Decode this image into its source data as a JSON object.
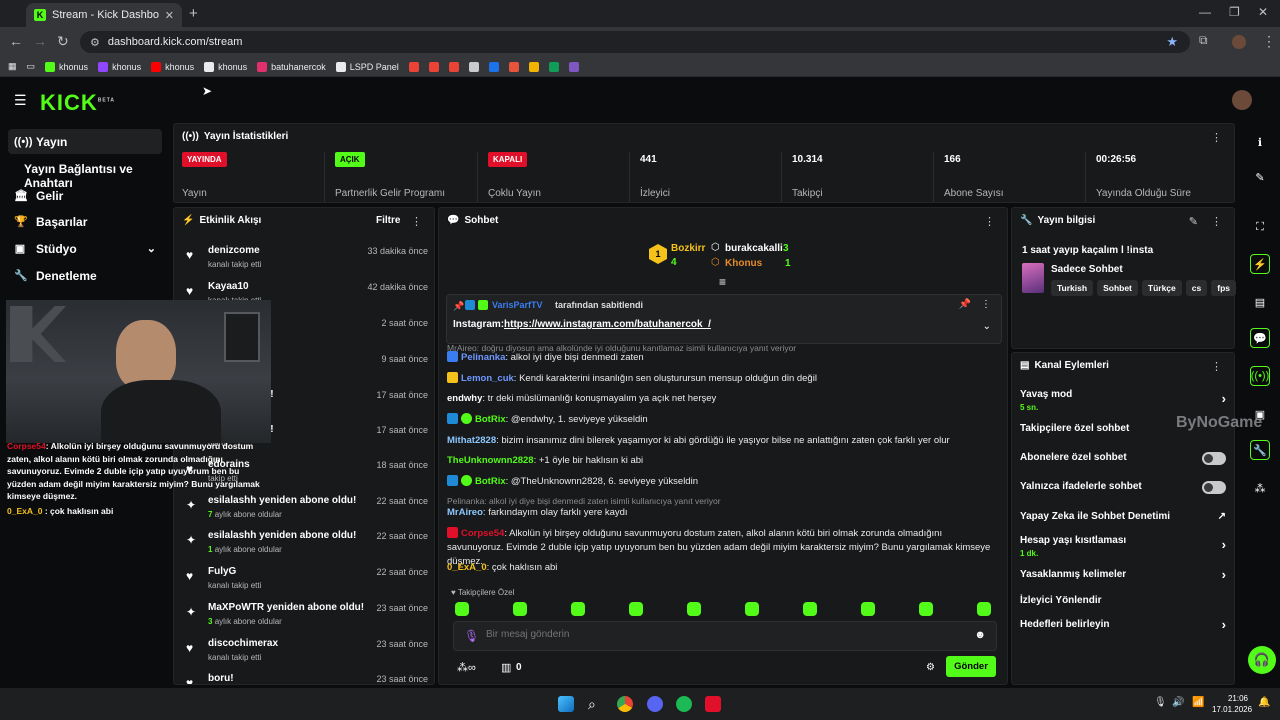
{
  "browser": {
    "tab_title": "Stream - Kick Dashboard",
    "url": "dashboard.kick.com/stream",
    "bookmarks": [
      {
        "label": "khonus",
        "color": "#53fc18"
      },
      {
        "label": "khonus",
        "color": "#9146ff"
      },
      {
        "label": "khonus",
        "color": "#ff0000"
      },
      {
        "label": "khonus",
        "color": "#e8eaed"
      },
      {
        "label": "batuhanercok",
        "color": "#e1306c"
      },
      {
        "label": "LSPD Panel",
        "color": "#e8eaed"
      }
    ]
  },
  "header": {
    "logo": "KICK",
    "logo_beta": "BETA"
  },
  "sidebar": {
    "items": [
      {
        "label": "Yayın",
        "icon": "broadcast-icon"
      },
      {
        "label": "Yayın Bağlantısı ve Anahtarı",
        "icon": ""
      },
      {
        "label": "Gelir",
        "icon": "bank-icon"
      },
      {
        "label": "Başarılar",
        "icon": "trophy-icon"
      },
      {
        "label": "Stüdyo",
        "icon": "studio-icon"
      },
      {
        "label": "Denetleme",
        "icon": "wrench-icon"
      }
    ]
  },
  "stats": {
    "title": "Yayın İstatistikleri",
    "items": [
      {
        "badge": "YAYINDA",
        "badge_color": "#e0102a",
        "label": "Yayın"
      },
      {
        "badge": "AÇIK",
        "badge_color": "#53fc18",
        "label": "Partnerlik Gelir Programı"
      },
      {
        "badge": "KAPALI",
        "badge_color": "#e0102a",
        "label": "Çoklu Yayın"
      },
      {
        "value": "441",
        "label": "İzleyici"
      },
      {
        "value": "10.314",
        "label": "Takipçi"
      },
      {
        "value": "166",
        "label": "Abone Sayısı"
      },
      {
        "value": "00:26:56",
        "label": "Yayında Olduğu Süre"
      }
    ]
  },
  "activity": {
    "title": "Etkinlik Akışı",
    "filter_label": "Filtre",
    "events": [
      {
        "name": "denizcome",
        "sub": "kanalı takip etti",
        "time": "33 dakika önce",
        "icon": "heart-icon"
      },
      {
        "name": "Kayaa10",
        "sub": "kanalı takip etti",
        "time": "42 dakika önce",
        "icon": "heart-icon"
      },
      {
        "name": "m",
        "sub": "",
        "time": "2 saat önce",
        "icon": "heart-icon"
      },
      {
        "name": "",
        "sub": "",
        "time": "9 saat önce",
        "icon": "heart-icon"
      },
      {
        "name": "n abone oldu!",
        "sub": "ulardı",
        "time": "17 saat önce",
        "icon": "star-icon"
      },
      {
        "name": "n abone oldu!",
        "sub": "ulardı",
        "time": "17 saat önce",
        "icon": "star-icon"
      },
      {
        "name": "edorains",
        "sub": "takip etti",
        "time": "18 saat önce",
        "icon": "heart-icon"
      },
      {
        "name": "esilalashh yeniden abone oldu!",
        "sub_count": "7",
        "sub": "aylık abone oldular",
        "time": "22 saat önce",
        "icon": "star-icon"
      },
      {
        "name": "esilalashh yeniden abone oldu!",
        "sub_count": "1",
        "sub": "aylık abone oldular",
        "time": "22 saat önce",
        "icon": "star-icon"
      },
      {
        "name": "FulyG",
        "sub": "kanalı takip etti",
        "time": "22 saat önce",
        "icon": "heart-icon"
      },
      {
        "name": "MaXPoWTR yeniden abone oldu!",
        "sub_count": "3",
        "sub": "aylık abone oldular",
        "time": "23 saat önce",
        "icon": "star-icon"
      },
      {
        "name": "discochimerax",
        "sub": "kanalı takip etti",
        "time": "23 saat önce",
        "icon": "heart-icon"
      },
      {
        "name": "boru!",
        "sub": "",
        "time": "23 saat önce",
        "icon": "heart-icon"
      }
    ]
  },
  "chat": {
    "title": "Sohbet",
    "leaders": [
      {
        "name": "Bozkirr",
        "count": "4"
      },
      {
        "name": "burakcakalli",
        "count": "3"
      },
      {
        "name": "Khonus",
        "count": "1"
      }
    ],
    "pinned_by": "VarisParfTV",
    "pinned_by_suffix": "tarafından sabitlendi",
    "pinned_prefix": "Instagram:",
    "pinned_link": "https://www.instagram.com/batuhanercok_/",
    "reply_preview_top": "MrAireo: doğru diyosun ama alkolünde iyi olduğunu kanıtlamaz isimli kullanıcıya yanıt veriyor",
    "messages": [
      {
        "user": "Pelinanka",
        "color": "#6f98ff",
        "text": "alkol iyi diye bişi denmedi zaten"
      },
      {
        "user": "Lemon_cuk",
        "color": "#6f98ff",
        "text": "Kendi karakterini insanlığın sen oluşturursun mensup olduğun din değil"
      },
      {
        "user": "endwhy",
        "color": "#ffffff",
        "text": "tr deki müslümanlığı konuşmayalım ya açık net herşey"
      },
      {
        "user": "BotRix",
        "color": "#53fc18",
        "text": "@endwhy, 1. seviyeye yükseldin"
      },
      {
        "user": "Mithat2828",
        "color": "#8dc8ff",
        "text": "bizim insanımız dini bilerek yaşamıyor ki abi gördüğü ile yaşıyor bilse ne anlattığını zaten çok farklı yer olur"
      },
      {
        "user": "TheUnknownn2828",
        "color": "#53fc18",
        "text": "+1 öyle bir haklısın ki abi"
      },
      {
        "user": "BotRix",
        "color": "#53fc18",
        "text": "@TheUnknownn2828, 6. seviyeye yükseldin"
      },
      {
        "user": "MrAireo",
        "color": "#8dc8ff",
        "text": "farkındayım olay farklı yere kaydı"
      },
      {
        "user": "Corpse54",
        "color": "#e0102a",
        "text": "Alkolün iyi birşey olduğunu savunmuyoru dostum zaten, alkol alanın kötü biri olmak zorunda olmadığını savunuyoruz. Evimde 2 duble içip yatıp uyuyorum ben bu yüzden adam değil miyim karaktersiz miyim? Bunu yargılamak kimseye düşmez."
      },
      {
        "user": "0_ExA_0",
        "color": "#f5c21b",
        "text": "çok haklısın abi"
      }
    ],
    "reply_preview_mid": "Pelinanka: alkol iyi diye bişi denmedi zaten isimli kullanıcıya yanıt veriyor",
    "followers_only_label": "Takipçilere Özel",
    "input_placeholder": "Bir mesaj gönderin",
    "kicks_count": "0",
    "send_label": "Gönder"
  },
  "stream_info": {
    "title": "Yayın bilgisi",
    "stream_title": "1 saat yayıp kaçalım l !insta",
    "category": "Sadece Sohbet",
    "tags": [
      "Turkish",
      "Sohbet",
      "Türkçe",
      "cs",
      "fps"
    ]
  },
  "channel_actions": {
    "title": "Kanal Eylemleri",
    "items": [
      {
        "label": "Yavaş mod",
        "sub": "5 sn.",
        "control": "chevron"
      },
      {
        "label": "Takipçilere özel sohbet",
        "sub": "",
        "control": "none"
      },
      {
        "label": "Abonelere özel sohbet",
        "sub": "",
        "control": "toggle"
      },
      {
        "label": "Yalnızca ifadelerle sohbet",
        "sub": "",
        "control": "toggle"
      },
      {
        "label": "Yapay Zeka ile Sohbet Denetimi",
        "sub": "",
        "control": "external"
      },
      {
        "label": "Hesap yaşı kısıtlaması",
        "sub": "1 dk.",
        "control": "chevron"
      },
      {
        "label": "Yasaklanmış kelimeler",
        "sub": "",
        "control": "chevron"
      },
      {
        "label": "İzleyici Yönlendir",
        "sub": "",
        "control": "none"
      },
      {
        "label": "Hedefleri belirleyin",
        "sub": "",
        "control": "chevron"
      }
    ]
  },
  "overlay": {
    "watermark": "ByNoGame",
    "cam_chat": [
      {
        "user": "Corpse54",
        "text": "Alkolün iyi birşey olduğunu savunmuyoru dostum zaten, alkol alanın kötü biri olmak zorunda olmadığını savunuyoruz. Evimde 2 duble içip yatıp uyuyorum ben bu yüzden adam değil miyim karaktersiz miyim? Bunu yargılamak kimseye düşmez."
      },
      {
        "user": "0_ExA_0",
        "text": "çok haklısın abi"
      }
    ]
  },
  "taskbar": {
    "time": "21:06",
    "date": "17.01.2026"
  }
}
